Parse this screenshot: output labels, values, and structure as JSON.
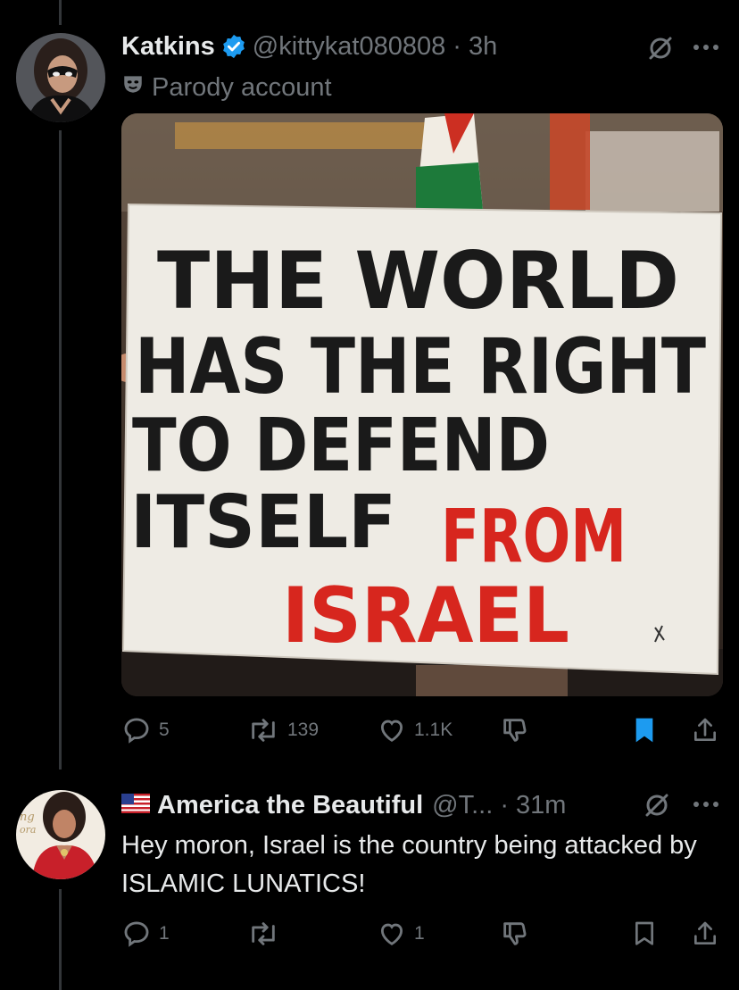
{
  "tweet": {
    "author": {
      "name": "Katkins",
      "handle": "@kittykat080808",
      "time": "3h",
      "label": "Parody account",
      "avatar_icon": "masked-heroine-avatar"
    },
    "image": {
      "sign_lines_black": [
        "THE WORLD",
        "HAS THE RIGHT",
        "TO DEFEND",
        "ITSELF"
      ],
      "sign_word_red_inline": "FROM",
      "sign_last_line_red": "ISRAEL"
    },
    "actions": {
      "replies": "5",
      "reposts": "139",
      "likes": "1.1K",
      "bookmarked": true
    }
  },
  "reply": {
    "author": {
      "flag": "🇺🇸",
      "name": "America the Beautiful",
      "handle": "@T...",
      "time": "31m"
    },
    "text": "Hey moron, Israel is the country being attacked by ISLAMIC LUNATICS!",
    "actions": {
      "replies": "1",
      "reposts": "",
      "likes": "1",
      "bookmarked": false
    }
  },
  "colors": {
    "background": "#000000",
    "text_primary": "#e7e9ea",
    "text_secondary": "#71767b",
    "verified_blue": "#1d9bf0",
    "bookmark_blue": "#1d9bf0",
    "sign_red": "#d7261e"
  }
}
